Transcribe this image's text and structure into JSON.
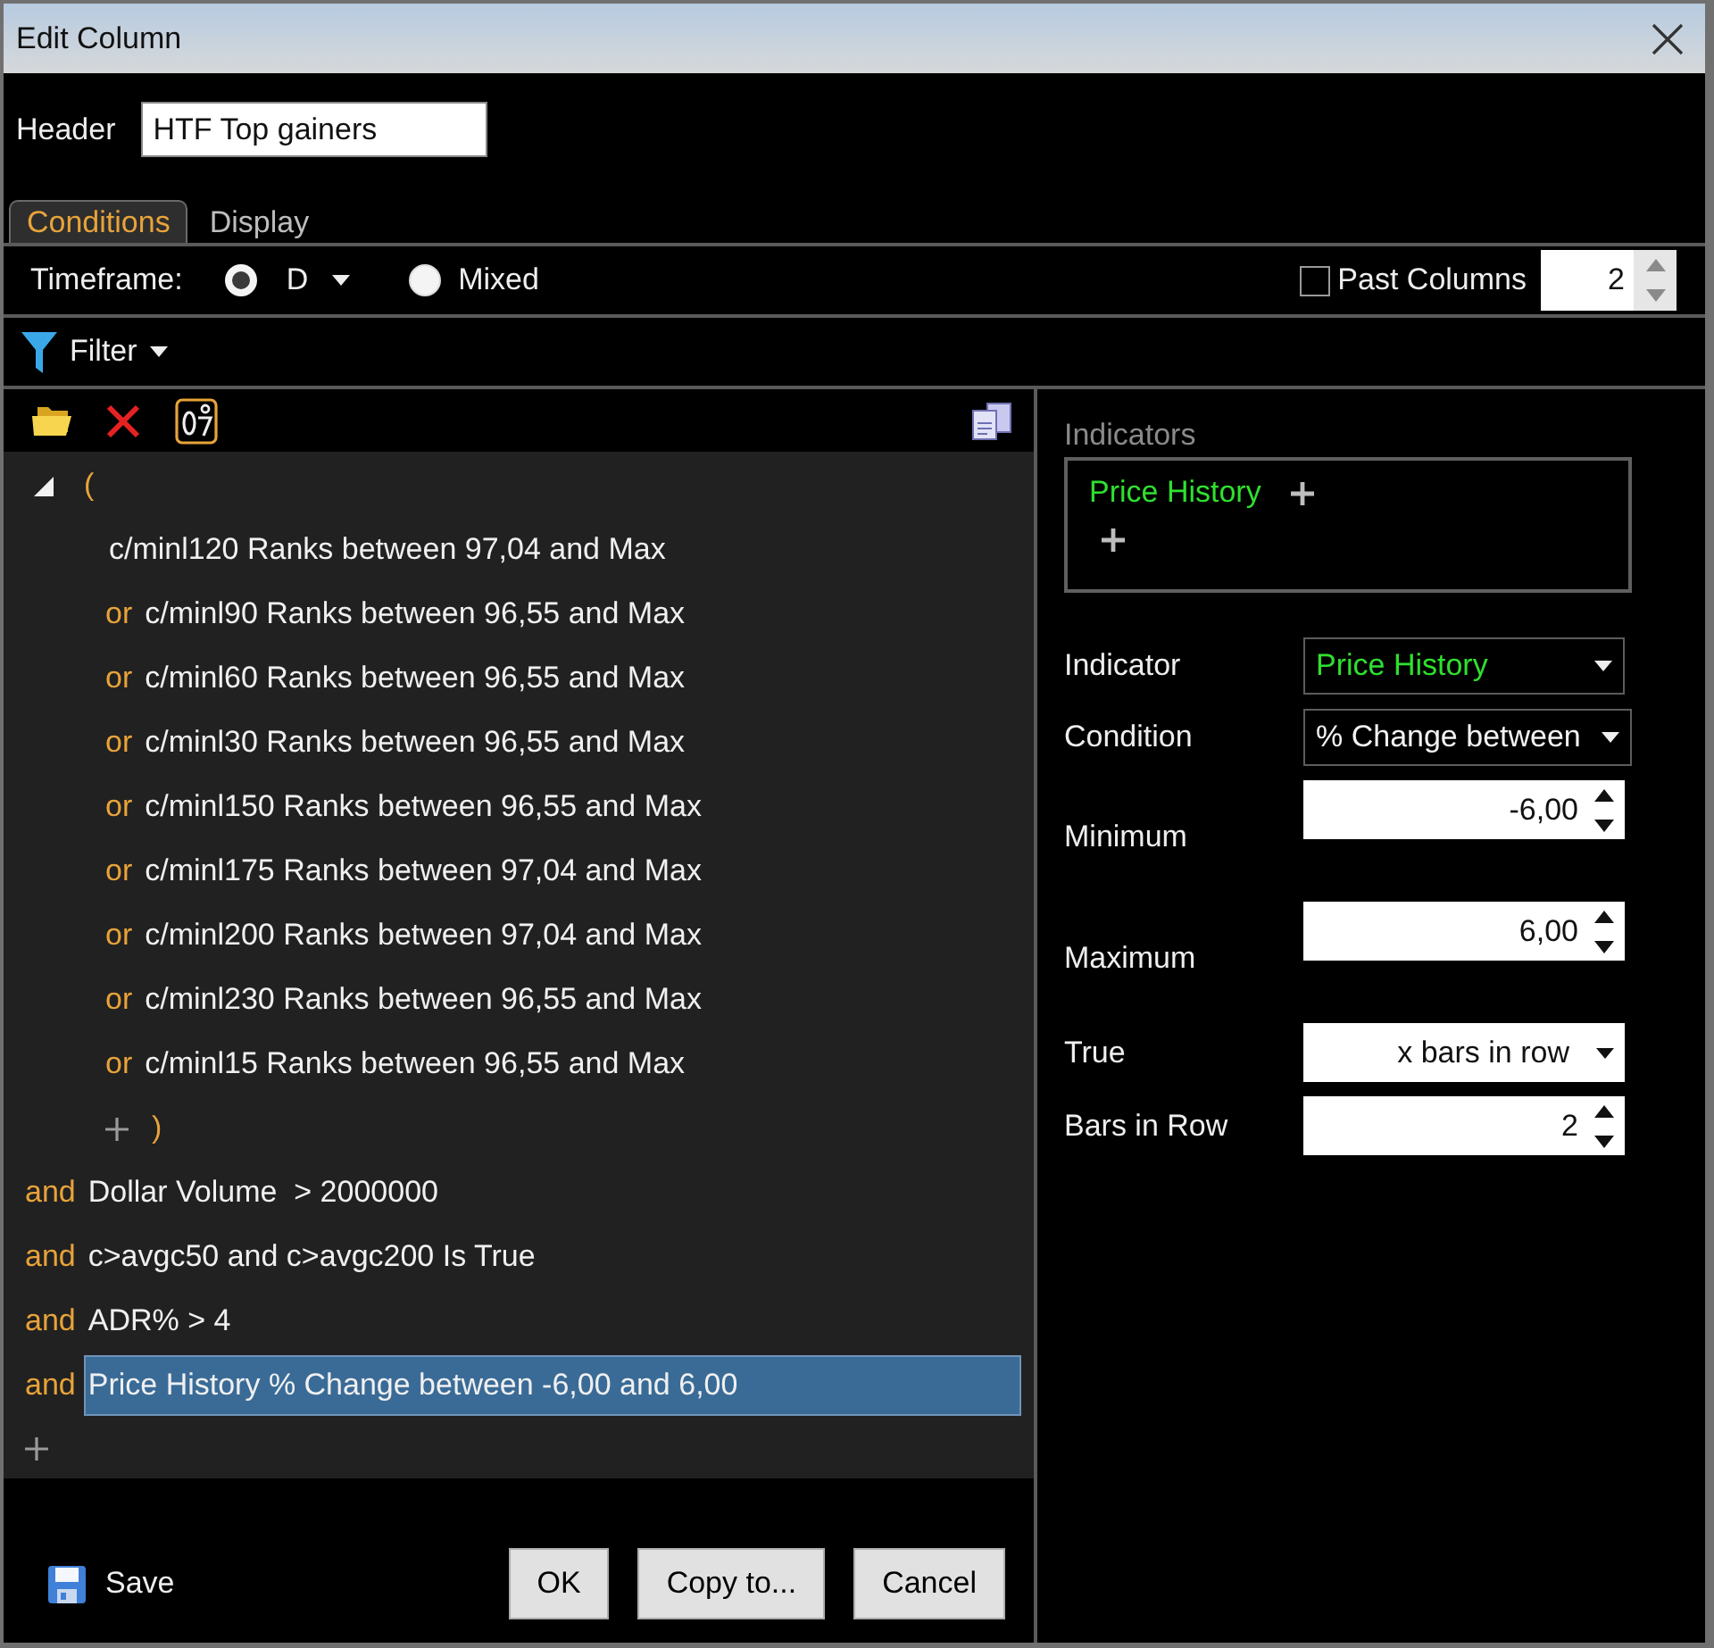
{
  "window": {
    "title": "Edit Column"
  },
  "header": {
    "label": "Header",
    "value": "HTF Top gainers"
  },
  "tabs": [
    {
      "label": "Conditions",
      "selected": true
    },
    {
      "label": "Display",
      "selected": false
    }
  ],
  "timeframe": {
    "label": "Timeframe:",
    "options": [
      {
        "kind": "dropdown",
        "label": "D",
        "selected": true
      },
      {
        "kind": "plain",
        "label": "Mixed",
        "selected": false
      }
    ]
  },
  "past_columns": {
    "label": "Past Columns",
    "checked": false,
    "value": "2"
  },
  "filter": {
    "label": "Filter"
  },
  "conditions": [
    {
      "kind": "group",
      "expanded": true,
      "selected": false,
      "open": "(",
      "close": ")",
      "children": [
        {
          "text": "c/minl120 Ranks between 97,04 and Max",
          "selected": false
        },
        {
          "connector": "or",
          "text": "c/minl90 Ranks between 96,55 and Max",
          "selected": false
        },
        {
          "connector": "or",
          "text": "c/minl60 Ranks between 96,55 and Max",
          "selected": false
        },
        {
          "connector": "or",
          "text": "c/minl30 Ranks between 96,55 and Max",
          "selected": false
        },
        {
          "connector": "or",
          "text": "c/minl150 Ranks between 96,55 and Max",
          "selected": false
        },
        {
          "connector": "or",
          "text": "c/minl175 Ranks between 97,04 and Max",
          "selected": false
        },
        {
          "connector": "or",
          "text": "c/minl200 Ranks between 97,04 and Max",
          "selected": false
        },
        {
          "connector": "or",
          "text": "c/minl230 Ranks between 96,55 and Max",
          "selected": false
        },
        {
          "connector": "or",
          "text": "c/minl15 Ranks between 96,55 and Max",
          "selected": false
        }
      ]
    },
    {
      "kind": "condition",
      "connector": "and",
      "text": "Dollar Volume  > 2000000",
      "selected": false
    },
    {
      "kind": "condition",
      "connector": "and",
      "text": "c>avgc50 and c>avgc200 Is True",
      "selected": false
    },
    {
      "kind": "condition",
      "connector": "and",
      "text": "ADR% > 4",
      "selected": false
    },
    {
      "kind": "condition",
      "connector": "and",
      "text": "Price History % Change between -6,00 and 6,00",
      "selected": true
    }
  ],
  "indicators": {
    "label": "Indicators",
    "items": [
      {
        "name": "Price History"
      }
    ]
  },
  "settings": [
    {
      "kind": "indicator",
      "label": "Indicator",
      "value": "Price History"
    },
    {
      "kind": "select",
      "label": "Condition",
      "value": "% Change between"
    },
    {
      "kind": "bound",
      "label": "Minimum",
      "value": "-6,00"
    },
    {
      "kind": "bound",
      "label": "Maximum",
      "value": "6,00"
    },
    {
      "kind": "dropdown",
      "label": "True",
      "value": "x bars in row"
    },
    {
      "kind": "spinner",
      "label": "Bars in Row",
      "value": "2"
    }
  ],
  "save": {
    "label": "Save"
  },
  "buttons": [
    {
      "label": "OK"
    },
    {
      "label": "Copy to..."
    },
    {
      "label": "Cancel"
    }
  ]
}
